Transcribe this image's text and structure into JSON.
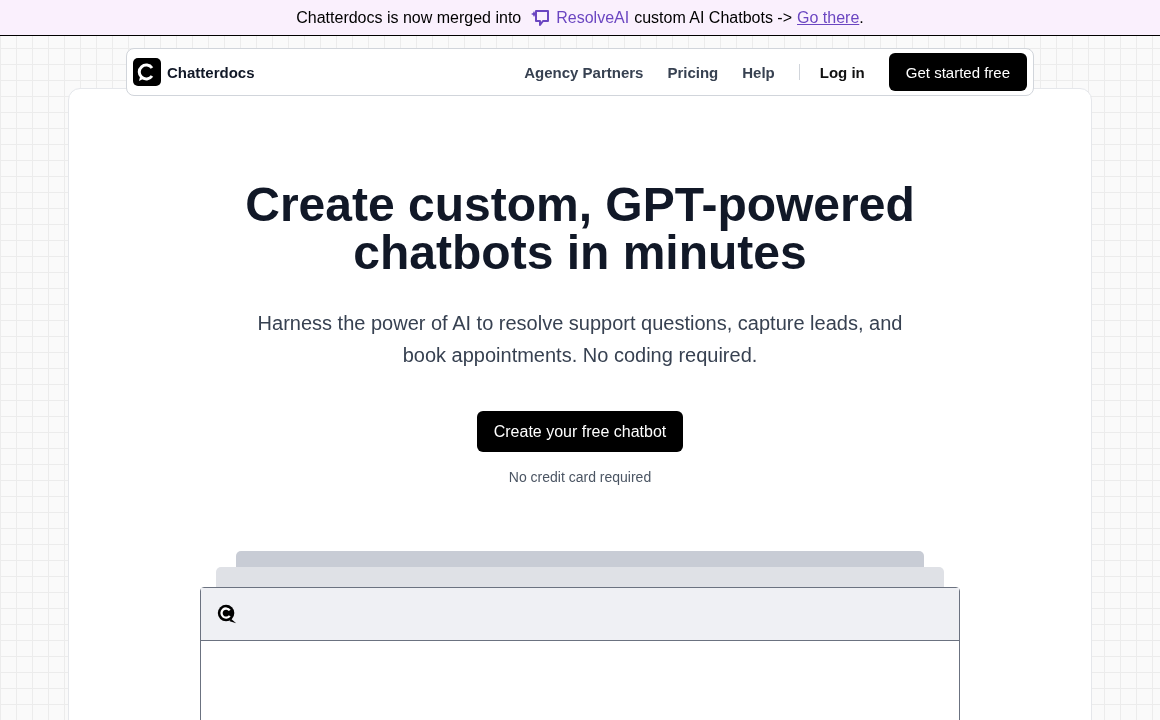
{
  "banner": {
    "before": "Chatterdocs is now merged into",
    "brand": "ResolveAI",
    "after": "custom AI Chatbots ->",
    "link": "Go there",
    "end": "."
  },
  "nav": {
    "logo": "Chatterdocs",
    "links": [
      "Agency Partners",
      "Pricing",
      "Help"
    ],
    "login": "Log in",
    "cta": "Get started free"
  },
  "hero": {
    "title": "Create custom, GPT-powered chatbots in minutes",
    "subtitle": "Harness the power of AI to resolve support questions, capture leads, and book appointments. No coding required.",
    "button": "Create your free chatbot",
    "note": "No credit card required"
  },
  "preview": {
    "kind": "chat-window"
  }
}
